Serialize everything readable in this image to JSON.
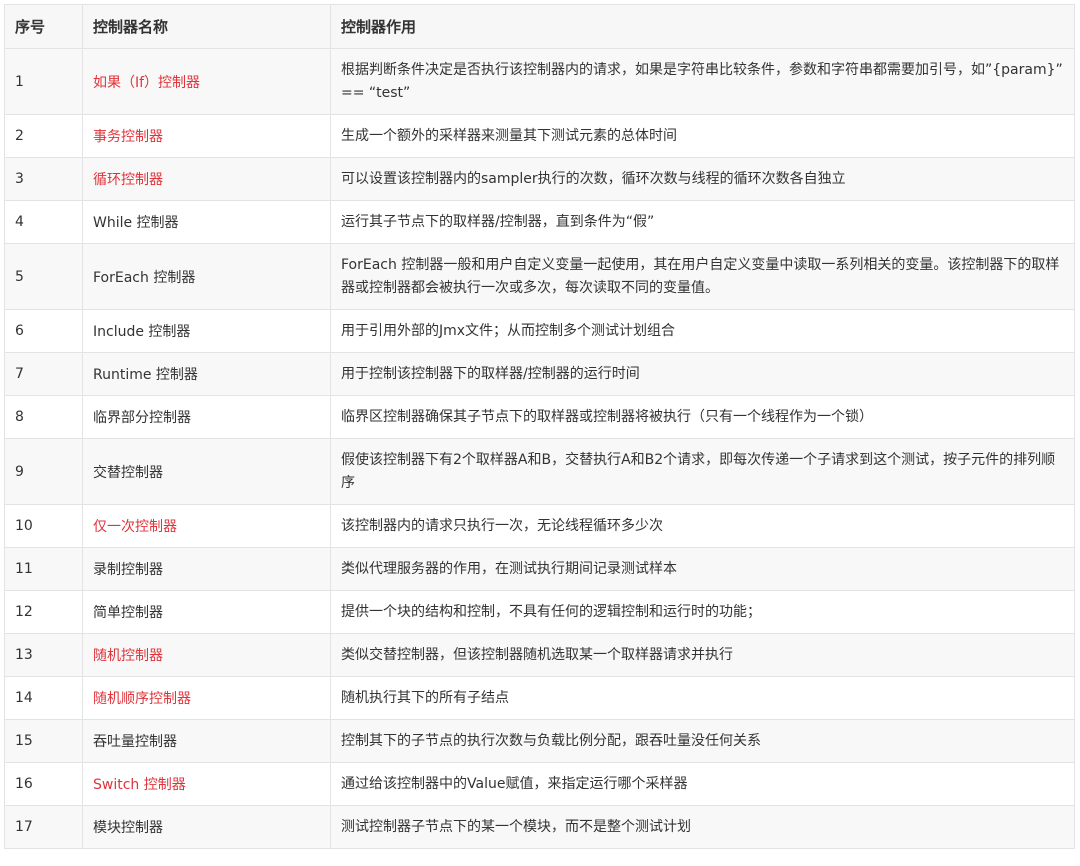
{
  "table": {
    "headers": [
      "序号",
      "控制器名称",
      "控制器作用"
    ],
    "rows": [
      {
        "no": "1",
        "name": "如果（If）控制器",
        "desc": "根据判断条件决定是否执行该控制器内的请求，如果是字符串比较条件，参数和字符串都需要加引号，如”{param}” == “test”",
        "highlight": true
      },
      {
        "no": "2",
        "name": "事务控制器",
        "desc": "生成一个额外的采样器来测量其下测试元素的总体时间",
        "highlight": true
      },
      {
        "no": "3",
        "name": "循环控制器",
        "desc": "可以设置该控制器内的sampler执行的次数，循环次数与线程的循环次数各自独立",
        "highlight": true
      },
      {
        "no": "4",
        "name": "While 控制器",
        "desc": "运行其子节点下的取样器/控制器，直到条件为“假”",
        "highlight": false
      },
      {
        "no": "5",
        "name": "ForEach 控制器",
        "desc": "ForEach 控制器一般和用户自定义变量一起使用，其在用户自定义变量中读取一系列相关的变量。该控制器下的取样器或控制器都会被执行一次或多次，每次读取不同的变量值。",
        "highlight": false
      },
      {
        "no": "6",
        "name": "Include 控制器",
        "desc": "用于引用外部的Jmx文件；从而控制多个测试计划组合",
        "highlight": false
      },
      {
        "no": "7",
        "name": "Runtime 控制器",
        "desc": "用于控制该控制器下的取样器/控制器的运行时间",
        "highlight": false
      },
      {
        "no": "8",
        "name": "临界部分控制器",
        "desc": "临界区控制器确保其子节点下的取样器或控制器将被执行（只有一个线程作为一个锁）",
        "highlight": false
      },
      {
        "no": "9",
        "name": "交替控制器",
        "desc": "假使该控制器下有2个取样器A和B，交替执行A和B2个请求，即每次传递一个子请求到这个测试，按子元件的排列顺序",
        "highlight": false
      },
      {
        "no": "10",
        "name": "仅一次控制器",
        "desc": "该控制器内的请求只执行一次，无论线程循环多少次",
        "highlight": true
      },
      {
        "no": "11",
        "name": "录制控制器",
        "desc": "类似代理服务器的作用，在测试执行期间记录测试样本",
        "highlight": false
      },
      {
        "no": "12",
        "name": "简单控制器",
        "desc": "提供一个块的结构和控制，不具有任何的逻辑控制和运行时的功能；",
        "highlight": false
      },
      {
        "no": "13",
        "name": "随机控制器",
        "desc": "类似交替控制器，但该控制器随机选取某一个取样器请求并执行",
        "highlight": true
      },
      {
        "no": "14",
        "name": "随机顺序控制器",
        "desc": "随机执行其下的所有子结点",
        "highlight": true
      },
      {
        "no": "15",
        "name": "吞吐量控制器",
        "desc": "控制其下的子节点的执行次数与负载比例分配，跟吞吐量没任何关系",
        "highlight": false
      },
      {
        "no": "16",
        "name": "Switch 控制器",
        "desc": "通过给该控制器中的Value赋值，来指定运行哪个采样器",
        "highlight": true
      },
      {
        "no": "17",
        "name": "模块控制器",
        "desc": "测试控制器子节点下的某一个模块，而不是整个测试计划",
        "highlight": false
      }
    ]
  },
  "colors": {
    "highlight_text": "#e0333a",
    "normal_text": "#333333",
    "border": "#e3e3e3",
    "stripe": "#f8f8f8"
  }
}
